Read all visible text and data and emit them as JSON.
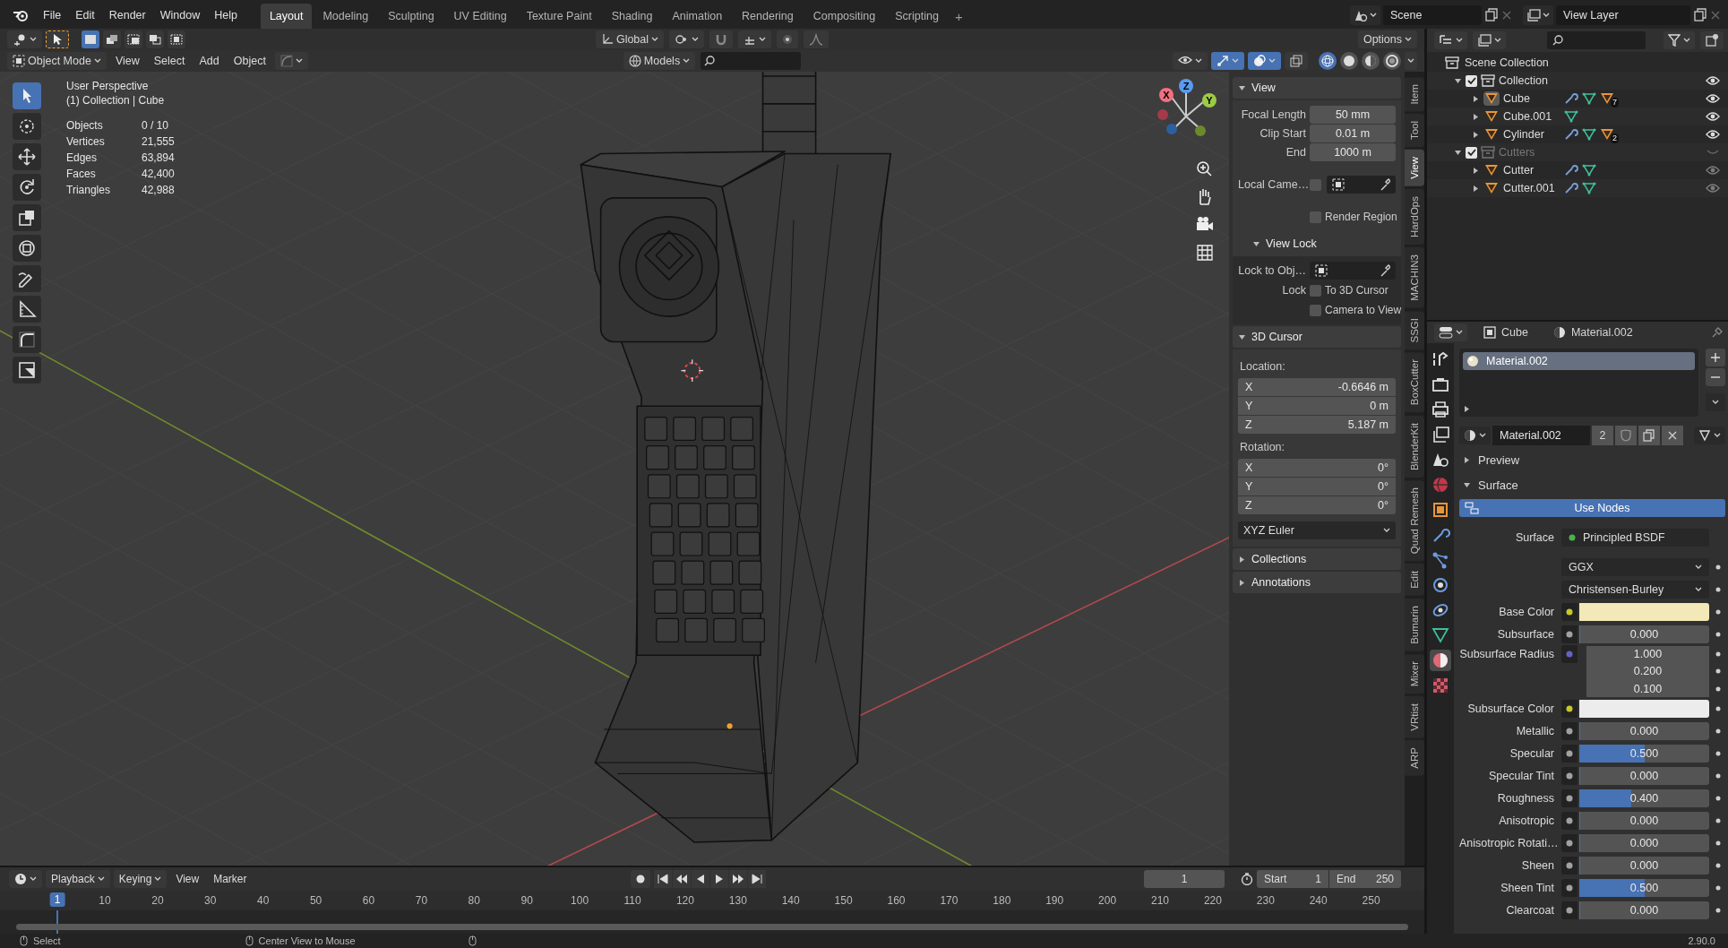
{
  "topbar": {
    "menus": [
      "File",
      "Edit",
      "Render",
      "Window",
      "Help"
    ],
    "workspaces": [
      {
        "label": "Layout",
        "selected": true
      },
      {
        "label": "Modeling",
        "selected": false
      },
      {
        "label": "Sculpting",
        "selected": false
      },
      {
        "label": "UV Editing",
        "selected": false
      },
      {
        "label": "Texture Paint",
        "selected": false
      },
      {
        "label": "Shading",
        "selected": false
      },
      {
        "label": "Animation",
        "selected": false
      },
      {
        "label": "Rendering",
        "selected": false
      },
      {
        "label": "Compositing",
        "selected": false
      },
      {
        "label": "Scripting",
        "selected": false
      }
    ],
    "add_workspace": "+",
    "scene": "Scene",
    "view_layer": "View Layer"
  },
  "viewport": {
    "header": {
      "select_modes": [
        {
          "kind": "set",
          "selected": true
        },
        {
          "kind": "extend",
          "selected": false
        },
        {
          "kind": "subtract",
          "selected": false
        },
        {
          "kind": "difference",
          "selected": false
        },
        {
          "kind": "intersect",
          "selected": false
        }
      ],
      "orientation": "Global",
      "options": "Options",
      "mode": "Object Mode",
      "menus": [
        "View",
        "Select",
        "Add",
        "Object"
      ],
      "collection": "Models",
      "toggles": [
        {
          "kind": "gizmos",
          "on": true
        },
        {
          "kind": "overlays",
          "on": true
        },
        {
          "kind": "xray",
          "on": false
        }
      ],
      "shading": [
        {
          "kind": "wireframe",
          "selected": true
        },
        {
          "kind": "solid",
          "selected": false
        },
        {
          "kind": "material",
          "selected": false
        },
        {
          "kind": "rendered",
          "selected": false
        }
      ]
    },
    "view_name": "User Perspective",
    "context": "(1) Collection | Cube",
    "stats": [
      {
        "label": "Objects",
        "value": "0 / 10"
      },
      {
        "label": "Vertices",
        "value": "21,555"
      },
      {
        "label": "Edges",
        "value": "63,894"
      },
      {
        "label": "Faces",
        "value": "42,400"
      },
      {
        "label": "Triangles",
        "value": "42,988"
      }
    ],
    "gizmo_axes": [
      "X",
      "Y",
      "Z"
    ]
  },
  "sidebar": {
    "tabs": [
      {
        "label": "Item",
        "selected": false
      },
      {
        "label": "Tool",
        "selected": false
      },
      {
        "label": "View",
        "selected": true
      },
      {
        "label": "HardOps",
        "selected": false
      },
      {
        "label": "MACHIN3",
        "selected": false
      },
      {
        "label": "SSGI",
        "selected": false
      },
      {
        "label": "BoxCutter",
        "selected": false
      },
      {
        "label": "BlenderKit",
        "selected": false
      },
      {
        "label": "Quad Remesh",
        "selected": false
      },
      {
        "label": "Edit",
        "selected": false
      },
      {
        "label": "Bumarin",
        "selected": false
      },
      {
        "label": "Mixer",
        "selected": false
      },
      {
        "label": "VRtist",
        "selected": false
      },
      {
        "label": "ARP",
        "selected": false
      }
    ],
    "view_panel": {
      "title": "View",
      "expanded": true,
      "fields": [
        {
          "label": "Focal Length",
          "value": "50 mm"
        },
        {
          "label": "Clip Start",
          "value": "0.01 m"
        },
        {
          "label": "End",
          "value": "1000 m"
        }
      ],
      "local_camera": {
        "label": "Local Came…",
        "checked": false
      },
      "render_region": {
        "label": "Render Region",
        "checked": false
      },
      "view_lock": {
        "title": "View Lock",
        "expanded": true,
        "lock_to_object": "Lock to Obj…",
        "lock_label": "Lock",
        "options": [
          {
            "label": "To 3D Cursor",
            "checked": false
          },
          {
            "label": "Camera to View",
            "checked": false
          }
        ]
      }
    },
    "cursor_panel": {
      "title": "3D Cursor",
      "expanded": true,
      "location_label": "Location:",
      "location": [
        {
          "axis": "X",
          "value": "-0.6646 m"
        },
        {
          "axis": "Y",
          "value": "0 m"
        },
        {
          "axis": "Z",
          "value": "5.187 m"
        }
      ],
      "rotation_label": "Rotation:",
      "rotation": [
        {
          "axis": "X",
          "value": "0°"
        },
        {
          "axis": "Y",
          "value": "0°"
        },
        {
          "axis": "Z",
          "value": "0°"
        }
      ],
      "rotation_mode": "XYZ Euler"
    },
    "collapsed_panels": [
      {
        "title": "Collections",
        "expanded": false
      },
      {
        "title": "Annotations",
        "expanded": false
      }
    ]
  },
  "outliner": {
    "root": "Scene Collection",
    "collections": [
      {
        "name": "Collection",
        "expanded": true,
        "checked": true,
        "visible": true,
        "objects": [
          {
            "name": "Cube",
            "active": true,
            "modifiers": true,
            "material_count": "7"
          },
          {
            "name": "Cube.001",
            "active": false,
            "modifiers": false
          },
          {
            "name": "Cylinder",
            "active": false,
            "modifiers": true,
            "material_count": "2"
          }
        ]
      },
      {
        "name": "Cutters",
        "expanded": true,
        "checked": true,
        "visible": false,
        "objects": [
          {
            "name": "Cutter",
            "active": false,
            "modifiers": true
          },
          {
            "name": "Cutter.001",
            "active": false,
            "modifiers": true
          }
        ]
      }
    ]
  },
  "properties": {
    "object": "Cube",
    "material": "Material.002",
    "tabs": [
      {
        "kind": "tool",
        "selected": false
      },
      {
        "kind": "render",
        "selected": false
      },
      {
        "kind": "output",
        "selected": false
      },
      {
        "kind": "view_layer",
        "selected": false
      },
      {
        "kind": "scene",
        "selected": false
      },
      {
        "kind": "world",
        "selected": false
      },
      {
        "kind": "object",
        "selected": false
      },
      {
        "kind": "modifiers",
        "selected": false
      },
      {
        "kind": "particles",
        "selected": false
      },
      {
        "kind": "physics",
        "selected": false
      },
      {
        "kind": "constraints",
        "selected": false
      },
      {
        "kind": "data",
        "selected": false
      },
      {
        "kind": "material",
        "selected": true
      },
      {
        "kind": "texture",
        "selected": false
      }
    ],
    "slots": [
      {
        "name": "Material.002",
        "selected": true
      }
    ],
    "datablock": {
      "name": "Material.002",
      "users": "2"
    },
    "panels": [
      {
        "title": "Preview",
        "expanded": false
      },
      {
        "title": "Surface",
        "expanded": true
      }
    ],
    "use_nodes": "Use Nodes",
    "surface_label": "Surface",
    "shader": "Principled BSDF",
    "dropdowns": [
      "GGX",
      "Christensen-Burley"
    ],
    "inputs": [
      {
        "kind": "color",
        "label": "Base Color",
        "color": "#f2e8b8"
      },
      {
        "kind": "float",
        "label": "Subsurface",
        "value": "0.000",
        "level": 0
      },
      {
        "kind": "vector",
        "label": "Subsurface Radius",
        "values": [
          "1.000",
          "0.200",
          "0.100"
        ]
      },
      {
        "kind": "color",
        "label": "Subsurface Color",
        "color": "#ececec"
      },
      {
        "kind": "float",
        "label": "Metallic",
        "value": "0.000",
        "level": 0
      },
      {
        "kind": "float",
        "label": "Specular",
        "value": "0.500",
        "level": 0.5
      },
      {
        "kind": "float",
        "label": "Specular Tint",
        "value": "0.000",
        "level": 0
      },
      {
        "kind": "float",
        "label": "Roughness",
        "value": "0.400",
        "level": 0.4
      },
      {
        "kind": "float",
        "label": "Anisotropic",
        "value": "0.000",
        "level": 0
      },
      {
        "kind": "float",
        "label": "Anisotropic Rotati…",
        "value": "0.000",
        "level": 0
      },
      {
        "kind": "float",
        "label": "Sheen",
        "value": "0.000",
        "level": 0
      },
      {
        "kind": "float",
        "label": "Sheen Tint",
        "value": "0.500",
        "level": 0.5
      },
      {
        "kind": "float",
        "label": "Clearcoat",
        "value": "0.000",
        "level": 0
      }
    ]
  },
  "timeline": {
    "menus": [
      "Playback",
      "Keying",
      "View",
      "Marker"
    ],
    "current_frame": "1",
    "start_label": "Start",
    "start": "1",
    "end_label": "End",
    "end": "250",
    "ruler": [
      "1",
      "10",
      "20",
      "30",
      "40",
      "50",
      "60",
      "70",
      "80",
      "90",
      "100",
      "110",
      "120",
      "130",
      "140",
      "150",
      "160",
      "170",
      "180",
      "190",
      "200",
      "210",
      "220",
      "230",
      "240",
      "250"
    ]
  },
  "status_bar": {
    "hints": [
      "Select",
      "Center View to Mouse"
    ],
    "version": "2.90.0"
  }
}
